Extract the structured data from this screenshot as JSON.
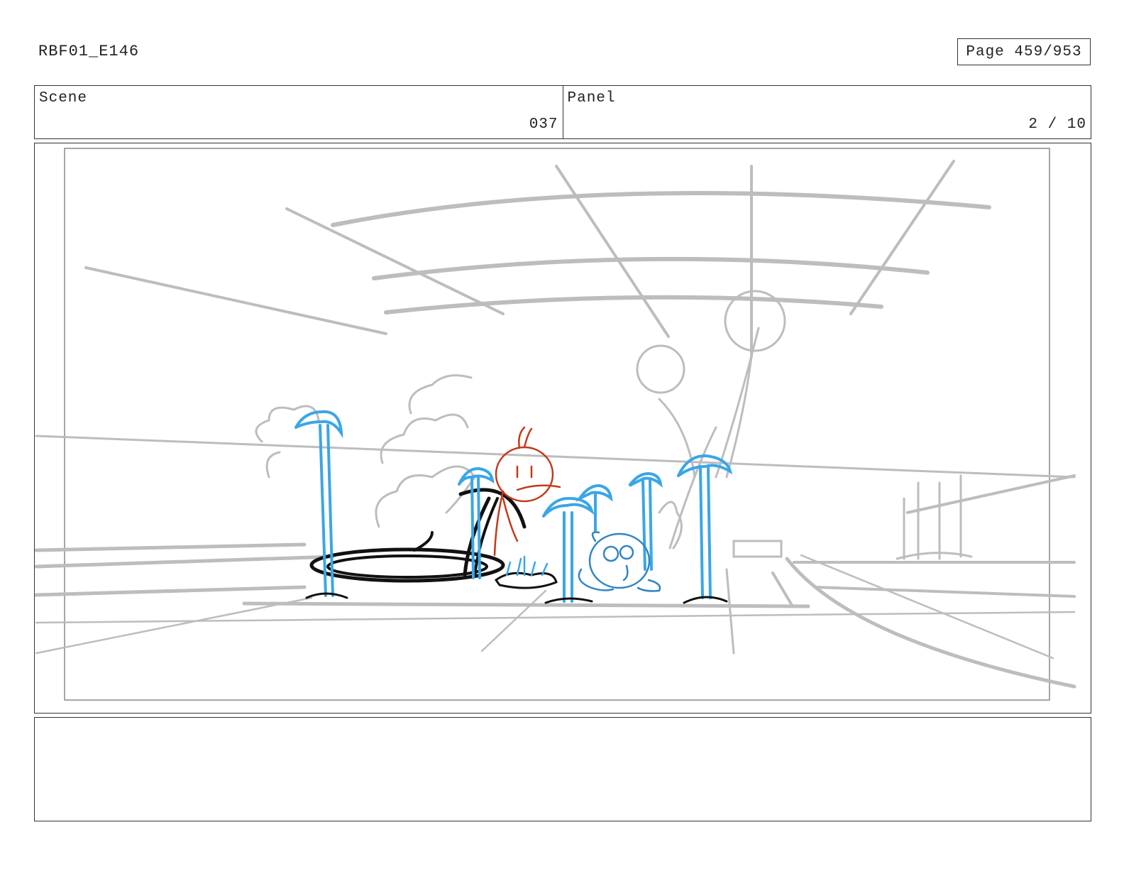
{
  "header": {
    "doc_id": "RBF01_E146",
    "page_label": "Page 459/953"
  },
  "info": {
    "scene_label": "Scene",
    "scene_value": "037",
    "panel_label": "Panel",
    "panel_value": "2 / 10"
  },
  "colors": {
    "sketch_gray": "#bdbdbd",
    "ink_black": "#111111",
    "water_blue": "#3aa6e6",
    "character_red": "#c2391b",
    "character_blue": "#2f86c4",
    "border": "#333333"
  },
  "notes": {
    "text": ""
  }
}
